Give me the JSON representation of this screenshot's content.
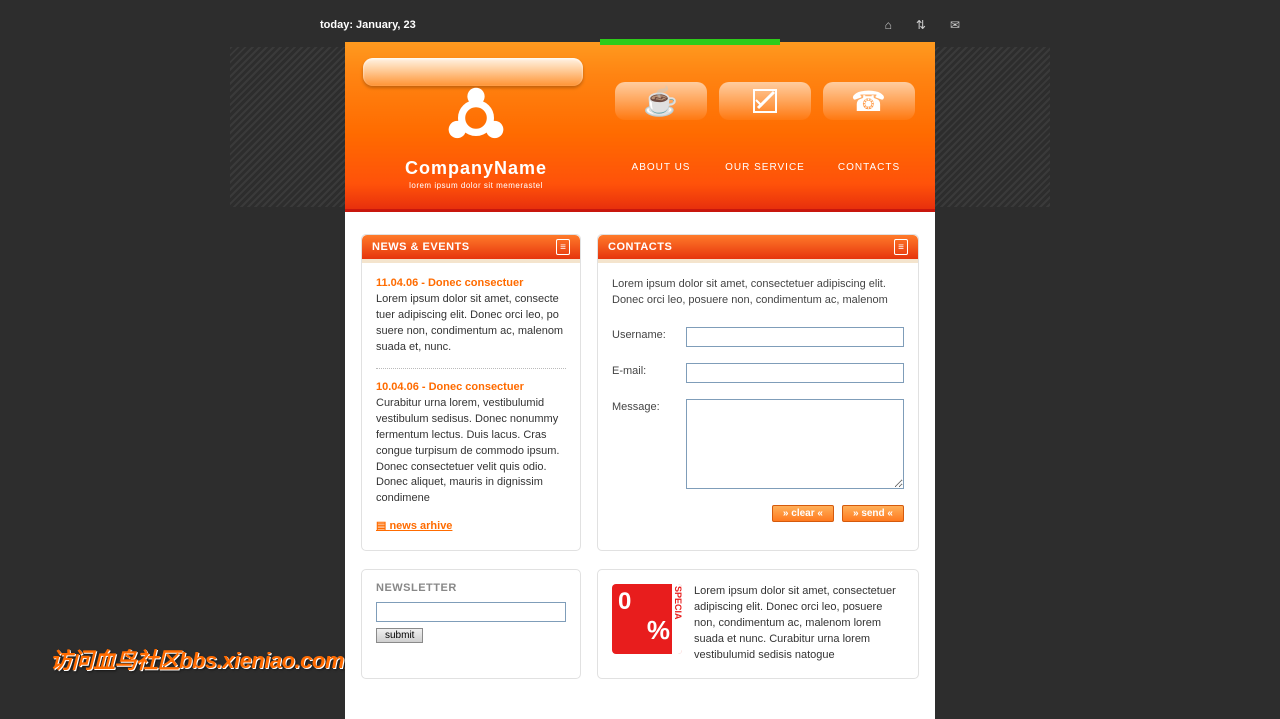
{
  "topbar": {
    "date_label": "today: January, 23"
  },
  "header": {
    "company_name_1": "Company",
    "company_name_2": "Name",
    "tagline": "lorem ipsum dolor sit memerastel",
    "nav": [
      {
        "label": "ABOUT US"
      },
      {
        "label": "OUR SERVICE"
      },
      {
        "label": "CONTACTS"
      }
    ]
  },
  "news_panel": {
    "title": "NEWS & EVENTS",
    "items": [
      {
        "headline": "11.04.06 - Donec consectuer",
        "body": "Lorem ipsum dolor sit amet, consecte tuer adipiscing elit. Donec orci leo, po suere non, condimentum ac, malenom suada et, nunc."
      },
      {
        "headline": "10.04.06 - Donec consectuer",
        "body": "Curabitur urna lorem, vestibulumid vestibulum sedisus. Donec nonummy fermentum lectus. Duis lacus. Cras congue turpisum de commodo ipsum. Donec consectetuer velit quis odio. Donec aliquet, mauris in dignissim condimene"
      }
    ],
    "archive_link": "news arhive"
  },
  "contacts_panel": {
    "title": "CONTACTS",
    "intro": "Lorem ipsum dolor sit amet, consectetuer adipiscing elit. Donec orci leo, posuere non, condimentum ac, malenom",
    "labels": {
      "username": "Username:",
      "email": "E-mail:",
      "message": "Message:"
    },
    "buttons": {
      "clear": "clear",
      "send": "send"
    }
  },
  "newsletter": {
    "title": "NEWSLETTER",
    "submit_label": "submit"
  },
  "promo": {
    "zero": "0",
    "percent": "%",
    "special": "SPECIA",
    "text": "Lorem ipsum dolor sit amet, consectetuer adipiscing elit. Donec orci leo, posuere non, condimentum ac, malenom lorem suada et nunc. Curabitur urna lorem vestibulumid sedisis natogue"
  },
  "watermark": "访问血鸟社区bbs.xieniao.com免费下载更多内容"
}
